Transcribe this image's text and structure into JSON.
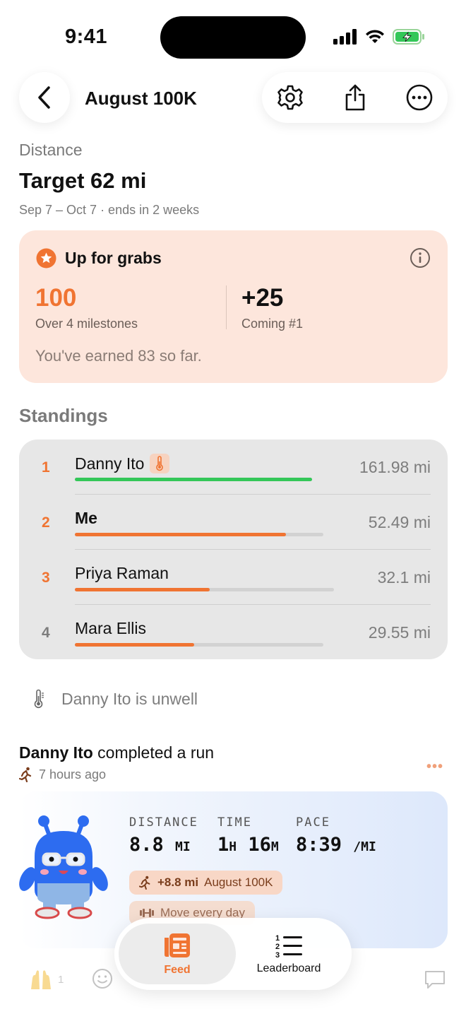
{
  "status_bar": {
    "time": "9:41"
  },
  "nav": {
    "title": "August 100K"
  },
  "challenge": {
    "type_label": "Distance",
    "target": "Target 62 mi",
    "dates": "Sep 7 – Oct 7 · ends in 2 weeks"
  },
  "grabs": {
    "title": "Up for grabs",
    "points": "100",
    "points_caption": "Over 4 milestones",
    "bonus": "+25",
    "bonus_caption": "Coming #1",
    "earned": "You've earned 83 so far."
  },
  "standings": {
    "title": "Standings",
    "rows": [
      {
        "rank": "1",
        "name": "Danny Ito",
        "distance": "161.98 mi",
        "progress": 1.0,
        "bar_color": "#34c759"
      },
      {
        "rank": "2",
        "name": "Me",
        "distance": "52.49 mi",
        "progress": 0.85,
        "bar_color": "#f07432"
      },
      {
        "rank": "3",
        "name": "Priya Raman",
        "distance": "32.1 mi",
        "progress": 0.52,
        "bar_color": "#f07432"
      },
      {
        "rank": "4",
        "name": "Mara Ellis",
        "distance": "29.55 mi",
        "progress": 0.48,
        "bar_color": "#f07432"
      }
    ]
  },
  "notice": {
    "text": "Danny Ito is unwell"
  },
  "post": {
    "author": "Danny Ito",
    "action": " completed a run",
    "time": "7 hours ago",
    "more": "•••",
    "stats": {
      "distance_label": "DISTANCE",
      "distance_value": "8.8",
      "distance_unit": "MI",
      "time_label": "TIME",
      "time_h": "1",
      "time_h_unit": "H",
      "time_m": "16",
      "time_m_unit": "M",
      "pace_label": "PACE",
      "pace_value": "8:39",
      "pace_unit": "/MI"
    },
    "chip_run_amount": "+8.8 mi",
    "chip_run_challenge": "August 100K",
    "chip_move": "Move every day",
    "reaction_count": "1"
  },
  "tabs": {
    "feed": "Feed",
    "leaderboard": "Leaderboard"
  },
  "colors": {
    "accent": "#f07432",
    "leader_bar": "#34c759",
    "grabs_bg": "#fde6dc",
    "standings_bg": "#e7e7e7"
  }
}
